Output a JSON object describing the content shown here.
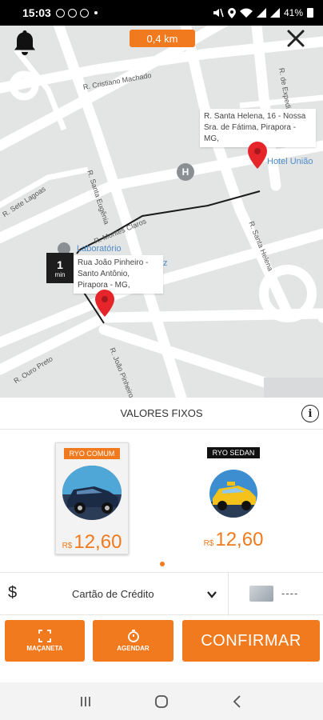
{
  "status_bar": {
    "time": "15:03",
    "battery": "41%",
    "icons": [
      "sms-icon",
      "whatsapp-icon",
      "app-icon",
      "dot",
      "mute-icon",
      "location-icon",
      "wifi-icon",
      "signal-icon",
      "battery-icon"
    ]
  },
  "map": {
    "distance": "0,4 km",
    "streets": [
      "R. Cristiano Machado",
      "R. Santa Eugênia",
      "R. Sete Lagoas",
      "R. Montes Claros",
      "R. de Expedição",
      "R. Santa Helena",
      "R. Ouro Preto",
      "R. João Pinheiro"
    ],
    "pois": {
      "hotel": "Hotel União",
      "lab": "Laboratório",
      "lab_tail": "z",
      "hospital_letter": "H"
    },
    "destination_address": "R. Santa Helena, 16 - Nossa Sra. de Fátima, Pirapora - MG,",
    "origin_address": "Rua João Pinheiro - Santo Antônio, Pirapora - MG,",
    "eta_value": "1",
    "eta_unit": "min"
  },
  "panel": {
    "title": "VALORES FIXOS",
    "vehicles": [
      {
        "tag": "RYO COMUM",
        "currency": "R$",
        "price": "12,60",
        "selected": true,
        "tag_color": "#f07a1d"
      },
      {
        "tag": "RYO SEDAN",
        "currency": "R$",
        "price": "12,60",
        "selected": false,
        "tag_color": "#111111"
      }
    ]
  },
  "payment": {
    "currency_symbol": "$",
    "method": "Cartão de Crédito",
    "card_number": "----"
  },
  "actions": {
    "macaneta": "MAÇANETA",
    "agendar": "AGENDAR",
    "confirm": "CONFIRMAR"
  },
  "colors": {
    "accent": "#f07a1d",
    "pin": "#e5252a"
  }
}
